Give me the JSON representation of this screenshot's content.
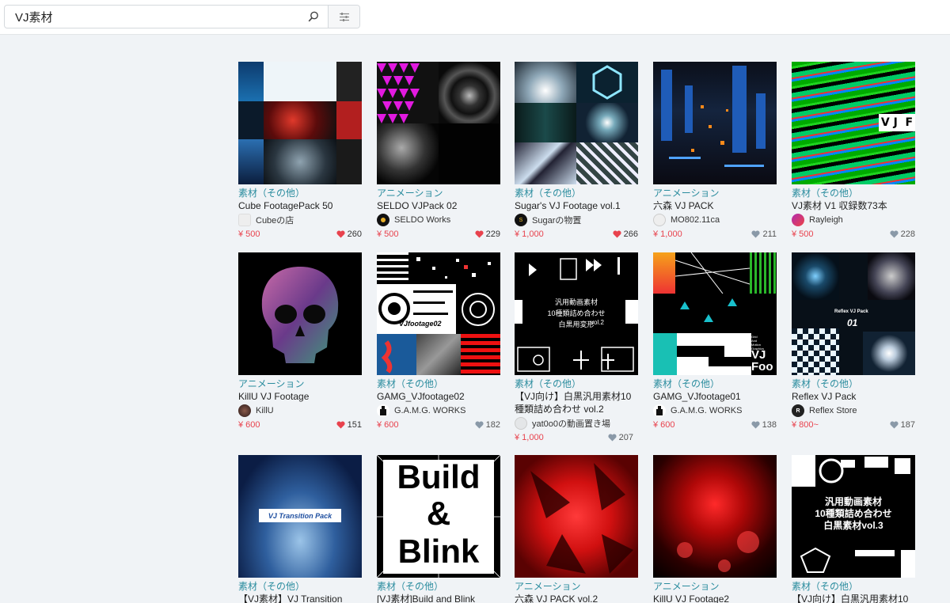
{
  "search": {
    "value": "VJ素材",
    "placeholder": ""
  },
  "colors": {
    "category": "#2a8c9e",
    "price": "#e8424d",
    "heart_liked": "#e8424d",
    "heart_default": "#8a99a8"
  },
  "items": [
    {
      "category": "素材（その他）",
      "title": "Cube FootagePack 50",
      "shop": "Cubeの店",
      "price": "¥ 500",
      "likes": "260",
      "liked": true
    },
    {
      "category": "アニメーション",
      "title": "SELDO VJPack 02",
      "shop": "SELDO Works",
      "price": "¥ 500",
      "likes": "229",
      "liked": true
    },
    {
      "category": "素材（その他）",
      "title": "Sugar's VJ Footage vol.1",
      "shop": "Sugarの物置",
      "price": "¥ 1,000",
      "likes": "266",
      "liked": true
    },
    {
      "category": "アニメーション",
      "title": "六森 VJ PACK",
      "shop": "MO802.11ca",
      "price": "¥ 1,000",
      "likes": "211",
      "liked": false
    },
    {
      "category": "素材（その他）",
      "title": "VJ素材 V1 収録数73本",
      "shop": "Rayleigh",
      "price": "¥ 500",
      "likes": "228",
      "liked": false
    },
    {
      "category": "アニメーション",
      "title": "KillU VJ Footage",
      "shop": "KillU",
      "price": "¥ 600",
      "likes": "151",
      "liked": true
    },
    {
      "category": "素材（その他）",
      "title": "GAMG_VJfootage02",
      "shop": "G.A.M.G. WORKS",
      "price": "¥ 600",
      "likes": "182",
      "liked": false
    },
    {
      "category": "素材（その他）",
      "title": "【VJ向け】白黒汎用素材10種類詰め合わせ vol.2",
      "shop": "yat0o0の動画置き場",
      "price": "¥ 1,000",
      "likes": "207",
      "liked": false
    },
    {
      "category": "素材（その他）",
      "title": "GAMG_VJfootage01",
      "shop": "G.A.M.G. WORKS",
      "price": "¥ 600",
      "likes": "138",
      "liked": false
    },
    {
      "category": "素材（その他）",
      "title": "Reflex VJ Pack",
      "shop": "Reflex Store",
      "price": "¥ 800~",
      "likes": "187",
      "liked": false
    },
    {
      "category": "素材（その他）",
      "title": "【VJ素材】VJ Transition Pack",
      "shop": "",
      "price": "",
      "likes": "",
      "liked": false
    },
    {
      "category": "素材（その他）",
      "title": "[VJ素材]Build and Blink",
      "shop": "",
      "price": "",
      "likes": "",
      "liked": false
    },
    {
      "category": "アニメーション",
      "title": "六森 VJ PACK vol.2",
      "shop": "",
      "price": "",
      "likes": "",
      "liked": false
    },
    {
      "category": "アニメーション",
      "title": "KillU VJ Footage2",
      "shop": "",
      "price": "",
      "likes": "",
      "liked": false
    },
    {
      "category": "素材（その他）",
      "title": "【VJ向け】白黒汎用素材10",
      "shop": "",
      "price": "",
      "likes": "",
      "liked": false
    }
  ],
  "thumb_text": {
    "vj_f": "V J  F",
    "vjfootage02": "VJfootage02",
    "pack_text": "汎用動画素材\n10種類詰め合わせ\n白黒用変形",
    "vol2": "vol.2",
    "reflex_title": "Reflex VJ Pack",
    "reflex_num": "01",
    "gamg01_small": "Grid\nAnd\nMotion\nGraphics",
    "gamg01_big": "VJ\nFoo",
    "transition": "VJ Transition Pack",
    "build": "Build",
    "amp": "&",
    "blink": "Blink",
    "last_text": "汎用動画素材\n10種類詰め合わせ\n白黒素材vol.3"
  }
}
